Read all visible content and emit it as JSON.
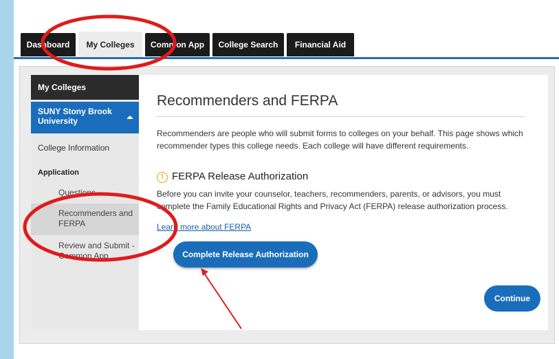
{
  "tabs": [
    {
      "label": "Dashboard"
    },
    {
      "label": "My Colleges"
    },
    {
      "label": "Common App"
    },
    {
      "label": "College Search"
    },
    {
      "label": "Financial Aid"
    }
  ],
  "sidebar": {
    "heading": "My Colleges",
    "college": "SUNY Stony Brook University",
    "college_info": "College Information",
    "section_label": "Application",
    "items": [
      {
        "label": "Questions"
      },
      {
        "label": "Recommenders and FERPA"
      },
      {
        "label": "Review and Submit - Common App"
      }
    ]
  },
  "main": {
    "title": "Recommenders and FERPA",
    "description": "Recommenders are people who will submit forms to colleges on your behalf. This page shows which recommender types this college needs. Each college will have different requirements.",
    "ferpa_heading": "FERPA Release Authorization",
    "ferpa_icon": "!",
    "ferpa_description": "Before you can invite your counselor, teachers, recommenders, parents, or advisors, you must complete the Family Educational Rights and Privacy Act (FERPA) release authorization process.",
    "learn_more": "Learn more about FERPA",
    "primary_button": "Complete Release Authorization",
    "continue_button": "Continue"
  },
  "colors": {
    "primary": "#1a6dbb",
    "tab_dark": "#1b1b1b",
    "annotation_red": "#e01b1b",
    "background": "#a9d5ea"
  }
}
